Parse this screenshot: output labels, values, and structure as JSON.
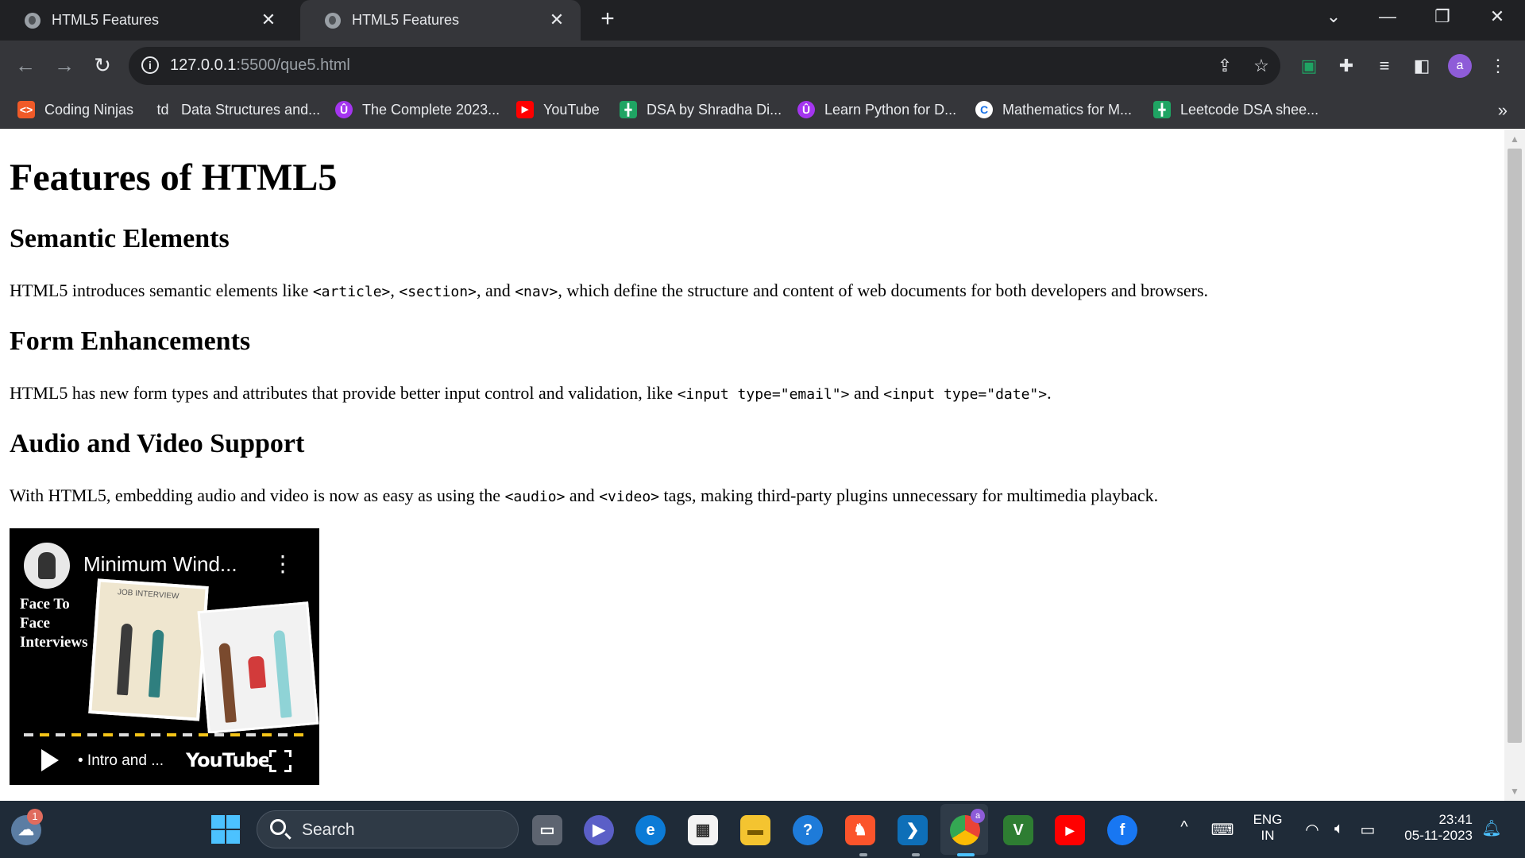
{
  "browser": {
    "tabs": [
      {
        "title": "HTML5 Features",
        "close": "✕"
      },
      {
        "title": "HTML5 Features",
        "close": "✕"
      }
    ],
    "new_tab": "+",
    "window_controls": {
      "menu": "⌄",
      "minimize": "—",
      "restore": "❐",
      "close": "✕"
    },
    "url_host": "127.0.0.1",
    "url_rest": ":5500/que5.html",
    "bookmarks": [
      {
        "label": "Coding Ninjas",
        "icon": "coding-ninjas-icon",
        "color": "#f05a28",
        "glyph": "<>"
      },
      {
        "label": "Data Structures and...",
        "icon": "td-icon",
        "color": "#35363a",
        "glyph": "td"
      },
      {
        "label": "The Complete 2023...",
        "icon": "udemy-icon",
        "color": "#a435f0",
        "glyph": "Û"
      },
      {
        "label": "YouTube",
        "icon": "youtube-icon",
        "color": "#ff0000",
        "glyph": "▶"
      },
      {
        "label": "DSA by Shradha Di...",
        "icon": "sheets-icon",
        "color": "#1fa463",
        "glyph": "╋"
      },
      {
        "label": "Learn Python for D...",
        "icon": "udemy-icon",
        "color": "#a435f0",
        "glyph": "Û"
      },
      {
        "label": "Mathematics for M...",
        "icon": "coursera-icon",
        "color": "#1a73e8",
        "glyph": "C"
      },
      {
        "label": "Leetcode DSA shee...",
        "icon": "sheets-icon",
        "color": "#1fa463",
        "glyph": "╋"
      }
    ],
    "bookmarks_more": "»",
    "avatar_letter": "a"
  },
  "page": {
    "h1": "Features of HTML5",
    "sections": [
      {
        "heading": "Semantic Elements",
        "parts": [
          "HTML5 introduces semantic elements like ",
          "<article>",
          ", ",
          "<section>",
          ", and ",
          "<nav>",
          ", which define the structure and content of web documents for both developers and browsers."
        ]
      },
      {
        "heading": "Form Enhancements",
        "parts": [
          "HTML5 has new form types and attributes that provide better input control and validation, like ",
          "<input type=\"email\">",
          " and ",
          "<input type=\"date\">",
          "."
        ]
      },
      {
        "heading": "Audio and Video Support",
        "parts": [
          "With HTML5, embedding audio and video is now as easy as using the ",
          "<audio>",
          " and ",
          "<video>",
          " tags, making third-party plugins unnecessary for multimedia playback."
        ]
      }
    ],
    "video": {
      "title": "Minimum Wind...",
      "menu": "⋮",
      "side_text": [
        "Face To",
        "Face",
        "Interviews"
      ],
      "card_caption": "JOB INTERVIEW",
      "chapter": "• Intro and ...",
      "brand": "YouTube"
    }
  },
  "taskbar": {
    "search_placeholder": "Search",
    "weather_badge": "1",
    "lang_top": "ENG",
    "lang_bottom": "IN",
    "time": "23:41",
    "date": "05-11-2023",
    "tray_up": "^",
    "chrome_badge": "a",
    "brave_glyph": "♞",
    "vscode_glyph": "❯",
    "veed_glyph": "V",
    "help_glyph": "?"
  }
}
